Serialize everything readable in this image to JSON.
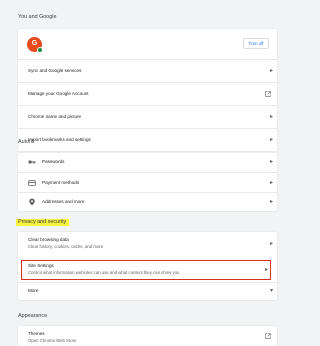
{
  "you_and_google": {
    "title": "You and Google",
    "avatar_letter": "G",
    "turn_off_label": "Turn off",
    "rows": [
      {
        "label": "Sync and Google services"
      },
      {
        "label": "Manage your Google Account"
      },
      {
        "label": "Chrome name and picture"
      },
      {
        "label": "Import bookmarks and settings"
      }
    ]
  },
  "autofill": {
    "title": "Autofill",
    "rows": [
      {
        "label": "Passwords",
        "icon": "key-icon"
      },
      {
        "label": "Payment methods",
        "icon": "credit-card-icon"
      },
      {
        "label": "Addresses and more",
        "icon": "location-pin-icon"
      }
    ]
  },
  "privacy": {
    "title": "Privacy and security",
    "clear_label": "Clear browsing data",
    "clear_sub": "Clear history, cookies, cache, and more",
    "site_label": "Site Settings",
    "site_sub": "Control what information websites can use and what content they can show you",
    "more_label": "More"
  },
  "appearance": {
    "title": "Appearance",
    "themes_label": "Themes",
    "themes_sub": "Open Chrome Web Store"
  },
  "colors": {
    "highlight": "#f7f43e",
    "site_settings_outline": "#d93025",
    "link_blue": "#1a73e8",
    "avatar": "#e8491d"
  }
}
